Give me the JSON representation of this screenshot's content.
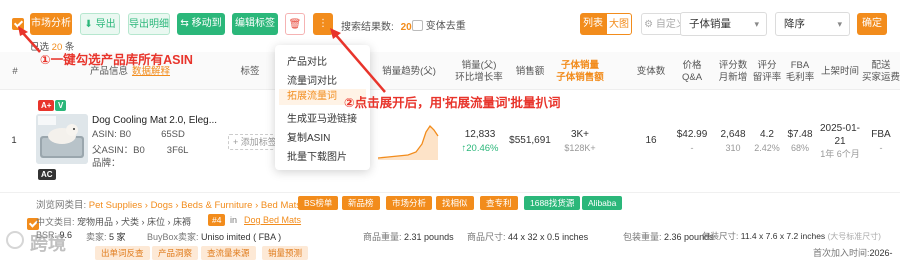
{
  "toolbar": {
    "market_analysis": "市场分析",
    "export": "导出",
    "export_detail": "导出明细",
    "move_to": "移动到",
    "edit_tags": "编辑标签",
    "search_results_label": "搜索结果数:",
    "search_results_count": "20",
    "variant_dedupe": "变体去重",
    "list_view": "列表",
    "grid_view": "大图",
    "custom_columns": "自定义列",
    "sort_field": "子体销量",
    "sort_order": "降序",
    "confirm": "确定",
    "selected_prefix": "已选",
    "selected_count": "20",
    "selected_suffix": "条"
  },
  "dropdown_menu": {
    "items": [
      "产品对比",
      "流量词对比",
      "拓展流量词",
      "生成亚马逊链接",
      "复制ASIN",
      "批量下载图片"
    ],
    "highlighted_index": 2
  },
  "annotations": {
    "a1": "①一键勾选产品库所有ASIN",
    "a2": "②点击展开后，用'拓展流量词'批量扒词"
  },
  "columns": {
    "index": "#",
    "product_info": "产品信息",
    "view_explanation": "数据解释",
    "tags": "标签",
    "sales_trend": "销量趋势(父)",
    "sales_parent": "销量(父)",
    "growth": "环比增长率",
    "revenue": "销售额",
    "child_sales": "子体销量",
    "child_revenue": "子体销售额",
    "variants": "变体数",
    "price": "价格",
    "qa": "Q&A",
    "ratings_count": "评分数",
    "monthly_new": "月新增",
    "rating": "评分",
    "retention": "留评率",
    "fba": "FBA",
    "gross_margin": "毛利率",
    "listed_time": "上架时间",
    "delivery": "配送",
    "buyer_ops": "买家运费"
  },
  "row": {
    "index": "1",
    "badge_a": "A+",
    "badge_v": "V",
    "badge_ac": "AC",
    "title": "Dog Cooling Mat 2.0, Eleg...",
    "asin_label": "ASIN: B0",
    "asin_tail": "65SD",
    "parent_asin_label": "父ASIN：B0",
    "parent_asin_tail": "3F6L",
    "brand_label": "品牌：",
    "add_tag": "+ 添加标签",
    "sales": "12,833",
    "growth": "↑20.46%",
    "revenue": "$551,691",
    "child_sales": "3K+",
    "child_revenue": "$128K+",
    "variants": "16",
    "price": "$42.99",
    "qa": "-",
    "ratings_count": "2,648",
    "monthly_new": "310",
    "rating": "4.2",
    "retention": "2.42%",
    "fba": "$7.48",
    "margin": "68%",
    "listed_date": "2025-01-21",
    "listed_age": "1年 6个月",
    "delivery": "FBA",
    "buyer_fee": "-"
  },
  "category": {
    "label": "浏览网类目:",
    "path": "Pet Supplies › Dogs › Beds & Furniture › Bed Mats",
    "tags": [
      "BS榜单",
      "新品榜",
      "市场分析",
      "找相似",
      "查专利",
      "1688找货源",
      "Alibaba"
    ]
  },
  "details": {
    "cn_category_label": "中文类目:",
    "cn_category": "宠物用品 › 犬类 › 床位 › 床褥",
    "rank_badge": "#4",
    "rank_in": "in",
    "rank_category": "Dog Bed Mats",
    "bsr_label": "BSR:",
    "bsr_value": "9.6",
    "sellers_label": "卖家:",
    "sellers_value": "5 家",
    "buybox_label": "BuyBox卖家:",
    "buybox_value": "Uniso        imited ( FBA )",
    "weight_label": "商品重量:",
    "weight_value": "2.31 pounds",
    "size_label": "商品尺寸:",
    "size_value": "44 x 32 x 0.5 inches",
    "pkg_weight_label": "包装重量:",
    "pkg_weight_value": "2.36 pounds",
    "pkg_size_label": "包装尺寸:",
    "pkg_size_value": "11.4 x 7.6 x 7.2 inches",
    "pkg_size_note": "(大号标准尺寸)",
    "first_added_label": "首次加入时间:",
    "first_added_value": "2026-"
  },
  "bottom_tags": [
    "出单词反查",
    "产品洞察",
    "查流量来源",
    "销量预测"
  ],
  "watermark": "跨境",
  "colors": {
    "accent": "#f28c1c",
    "green": "#2bb77a",
    "annotation": "#e8342b"
  }
}
